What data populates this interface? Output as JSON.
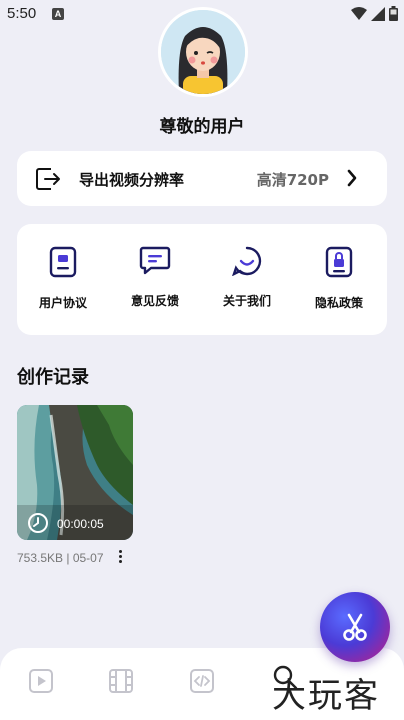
{
  "status": {
    "time": "5:50",
    "notification_badge": "A"
  },
  "profile": {
    "name": "尊敬的用户"
  },
  "resolution": {
    "label": "导出视频分辨率",
    "value": "高清720P"
  },
  "actions": [
    {
      "label": "用户协议",
      "icon": "document-icon"
    },
    {
      "label": "意见反馈",
      "icon": "message-icon"
    },
    {
      "label": "关于我们",
      "icon": "smile-icon"
    },
    {
      "label": "隐私政策",
      "icon": "lock-document-icon"
    }
  ],
  "records": {
    "title": "创作记录",
    "items": [
      {
        "duration": "00:00:05",
        "meta": "753.5KB | 05-07"
      }
    ]
  },
  "bottom_nav": [
    {
      "icon": "play-icon"
    },
    {
      "icon": "film-icon"
    },
    {
      "icon": "code-icon"
    },
    {
      "icon": "search-icon"
    }
  ],
  "watermark": "大玩客",
  "colors": {
    "background": "#eeeef6",
    "card": "#ffffff",
    "accent": "#4b3bd6",
    "accent_secondary": "#c21d84"
  }
}
